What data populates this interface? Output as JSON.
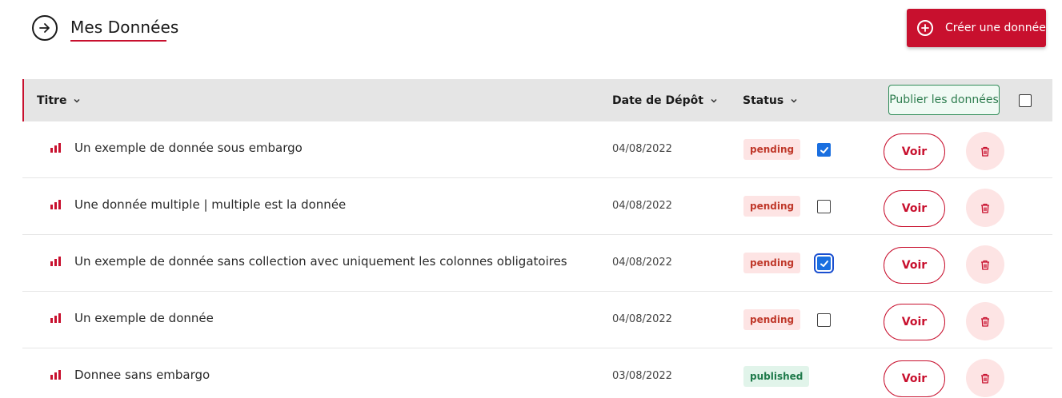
{
  "header": {
    "title": "Mes Données",
    "create_label": "Créer une donnée"
  },
  "table": {
    "columns": {
      "title": "Titre",
      "date": "Date de Dépôt",
      "status": "Status"
    },
    "publish_label": "Publier les données",
    "select_all_checked": false,
    "view_label": "Voir",
    "rows": [
      {
        "title": "Un exemple de donnée sous embargo",
        "date": "04/08/2022",
        "status": "pending",
        "checked": true,
        "focused": false
      },
      {
        "title": "Une donnée multiple | multiple est la donnée",
        "date": "04/08/2022",
        "status": "pending",
        "checked": false,
        "focused": false
      },
      {
        "title": "Un exemple de donnée sans collection avec uniquement les colonnes obligatoires",
        "date": "04/08/2022",
        "status": "pending",
        "checked": true,
        "focused": true
      },
      {
        "title": "Un exemple de donnée",
        "date": "04/08/2022",
        "status": "pending",
        "checked": false,
        "focused": false
      },
      {
        "title": "Donnee sans embargo",
        "date": "03/08/2022",
        "status": "published",
        "checked": null,
        "focused": false
      }
    ]
  },
  "icons": {
    "back": "arrow-right-circle-icon",
    "create": "plus-circle-icon",
    "sort": "chevron-down-icon",
    "row": "bar-chart-icon",
    "delete": "trash-icon"
  },
  "colors": {
    "accent": "#c8102e",
    "publish_green": "#2e7d4f",
    "checkbox_blue": "#1a6fe0",
    "header_bg": "#e5e5e5"
  }
}
